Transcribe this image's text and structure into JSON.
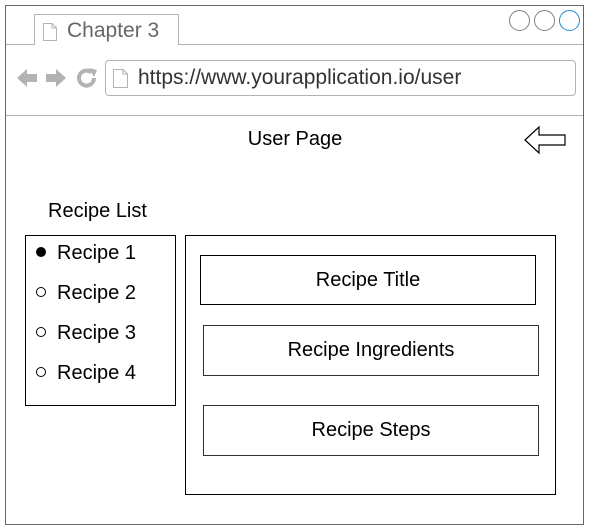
{
  "browser": {
    "tab_title": "Chapter 3",
    "url": "https://www.yourapplication.io/user",
    "icons": {
      "tab": "document-icon",
      "back": "arrow-left-icon",
      "forward": "arrow-right-icon",
      "reload": "reload-icon",
      "url": "document-icon"
    },
    "accent_color": "#1e8bd0"
  },
  "page": {
    "title": "User Page",
    "back_icon": "hollow-arrow-left-icon"
  },
  "recipe_list": {
    "heading": "Recipe List",
    "items": [
      {
        "label": "Recipe 1",
        "selected": true
      },
      {
        "label": "Recipe 2",
        "selected": false
      },
      {
        "label": "Recipe 3",
        "selected": false
      },
      {
        "label": "Recipe 4",
        "selected": false
      }
    ]
  },
  "detail": {
    "title_label": "Recipe Title",
    "ingredients_label": "Recipe Ingredients",
    "steps_label": "Recipe Steps"
  }
}
